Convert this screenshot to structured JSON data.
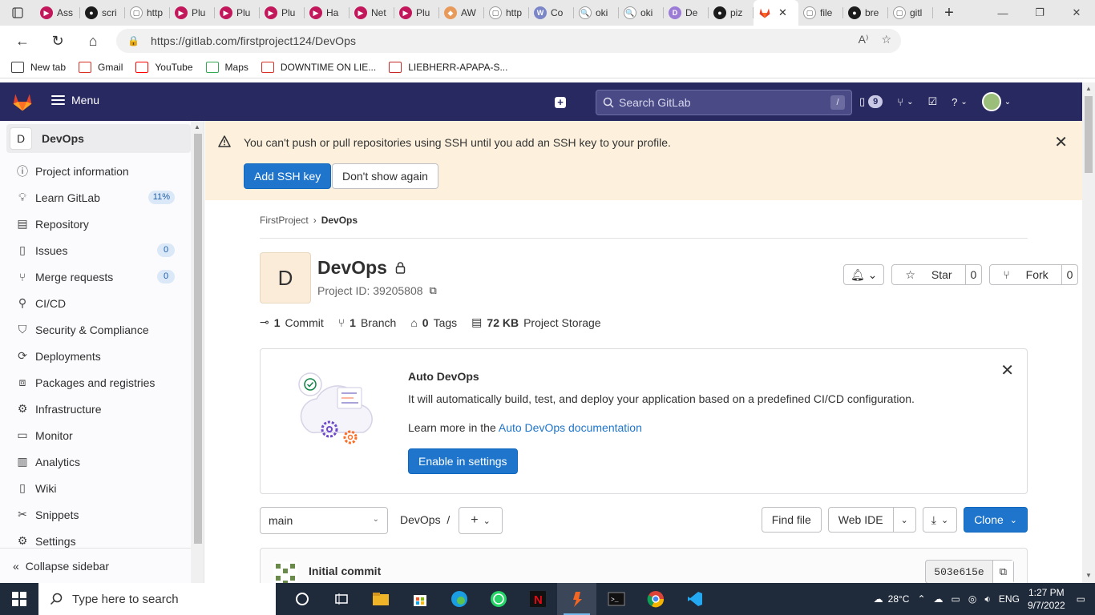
{
  "browser": {
    "tabs": [
      {
        "label": "Ass",
        "color": "#c2185b",
        "glyph": "▶"
      },
      {
        "label": "scri",
        "color": "#1b1b1b",
        "glyph": "●"
      },
      {
        "label": "http",
        "color": "#ffffff",
        "glyph": "▢"
      },
      {
        "label": "Plu",
        "color": "#c2185b",
        "glyph": "▶"
      },
      {
        "label": "Plu",
        "color": "#c2185b",
        "glyph": "▶"
      },
      {
        "label": "Plu",
        "color": "#c2185b",
        "glyph": "▶"
      },
      {
        "label": "Ha",
        "color": "#c2185b",
        "glyph": "▶"
      },
      {
        "label": "Net",
        "color": "#c2185b",
        "glyph": "▶"
      },
      {
        "label": "Plu",
        "color": "#c2185b",
        "glyph": "▶"
      },
      {
        "label": "AW",
        "color": "#e89a5a",
        "glyph": "◆"
      },
      {
        "label": "http",
        "color": "#ffffff",
        "glyph": "▢"
      },
      {
        "label": "Co",
        "color": "#7a86c8",
        "glyph": "W"
      },
      {
        "label": "oki",
        "color": "#ffffff",
        "glyph": "🔍"
      },
      {
        "label": "oki",
        "color": "#ffffff",
        "glyph": "🔍"
      },
      {
        "label": "De",
        "color": "#9b7bd6",
        "glyph": "D"
      },
      {
        "label": "piz",
        "color": "#1b1b1b",
        "glyph": "●"
      }
    ],
    "active_tab_glyph": "🦊",
    "tabs_after": [
      {
        "label": "file",
        "color": "#ffffff",
        "glyph": "▢"
      },
      {
        "label": "bre",
        "color": "#1b1b1b",
        "glyph": "●"
      },
      {
        "label": "gitl",
        "color": "#ffffff",
        "glyph": "▢"
      }
    ],
    "url": "https://gitlab.com/firstproject124/DevOps",
    "bookmarks": [
      {
        "label": "New tab",
        "icon": "tab-icon",
        "color": "#444"
      },
      {
        "label": "Gmail",
        "icon": "gmail-icon",
        "color": "#d93025"
      },
      {
        "label": "YouTube",
        "icon": "youtube-icon",
        "color": "#ff0000"
      },
      {
        "label": "Maps",
        "icon": "maps-icon",
        "color": "#34a853"
      },
      {
        "label": "DOWNTIME ON LIE...",
        "icon": "gmail-icon",
        "color": "#d93025"
      },
      {
        "label": "LIEBHERR-APAPA-S...",
        "icon": "liebherr-icon",
        "color": "#c62828"
      }
    ]
  },
  "gitlab": {
    "menu_label": "Menu",
    "search_placeholder": "Search GitLab",
    "search_shortcut": "/",
    "issues_count": "9",
    "sidebar": {
      "project_initial": "D",
      "project_name": "DevOps",
      "items": [
        {
          "label": "Project information",
          "icon": "info-icon",
          "badge": ""
        },
        {
          "label": "Learn GitLab",
          "icon": "bulb-icon",
          "badge": "11%"
        },
        {
          "label": "Repository",
          "icon": "doc-icon",
          "badge": ""
        },
        {
          "label": "Issues",
          "icon": "issues-icon",
          "badge": "0"
        },
        {
          "label": "Merge requests",
          "icon": "merge-icon",
          "badge": "0"
        },
        {
          "label": "CI/CD",
          "icon": "rocket-icon",
          "badge": ""
        },
        {
          "label": "Security & Compliance",
          "icon": "shield-icon",
          "badge": ""
        },
        {
          "label": "Deployments",
          "icon": "deploy-icon",
          "badge": ""
        },
        {
          "label": "Packages and registries",
          "icon": "package-icon",
          "badge": ""
        },
        {
          "label": "Infrastructure",
          "icon": "infra-icon",
          "badge": ""
        },
        {
          "label": "Monitor",
          "icon": "monitor-icon",
          "badge": ""
        },
        {
          "label": "Analytics",
          "icon": "chart-icon",
          "badge": ""
        },
        {
          "label": "Wiki",
          "icon": "book-icon",
          "badge": ""
        },
        {
          "label": "Snippets",
          "icon": "snippet-icon",
          "badge": ""
        },
        {
          "label": "Settings",
          "icon": "gear-icon",
          "badge": ""
        }
      ],
      "collapse_label": "Collapse sidebar"
    },
    "alert": {
      "text": "You can't push or pull repositories using SSH until you add an SSH key to your profile.",
      "primary": "Add SSH key",
      "secondary": "Don't show again"
    },
    "breadcrumb": {
      "parent": "FirstProject",
      "current": "DevOps"
    },
    "project": {
      "initial": "D",
      "name": "DevOps",
      "id_text": "Project ID: 39205808",
      "star_label": "Star",
      "star_count": "0",
      "fork_label": "Fork",
      "fork_count": "0"
    },
    "stats": [
      {
        "count": "1",
        "label": "Commit",
        "icon": "commit-icon"
      },
      {
        "count": "1",
        "label": "Branch",
        "icon": "branch-icon"
      },
      {
        "count": "0",
        "label": "Tags",
        "icon": "tag-icon"
      },
      {
        "count": "72 KB",
        "label": "Project Storage",
        "icon": "storage-icon"
      }
    ],
    "auto_devops": {
      "title": "Auto DevOps",
      "description": "It will automatically build, test, and deploy your application based on a predefined CI/CD configuration.",
      "learn_prefix": "Learn more in the ",
      "learn_link": "Auto DevOps documentation",
      "button": "Enable in settings"
    },
    "toolbar": {
      "branch": "main",
      "path": "DevOps",
      "path_sep": "/",
      "find_file": "Find file",
      "web_ide": "Web IDE",
      "clone": "Clone"
    },
    "commit": {
      "message": "Initial commit",
      "sha": "503e615e"
    }
  },
  "taskbar": {
    "search_placeholder": "Type here to search",
    "temperature": "28°C",
    "language": "ENG",
    "time": "1:27 PM",
    "date": "9/7/2022"
  }
}
